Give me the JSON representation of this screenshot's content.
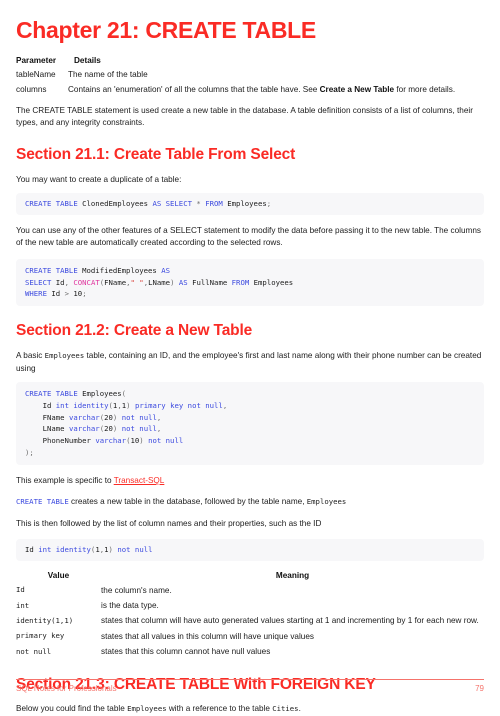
{
  "colors": {
    "heading_red": "#fa2b25",
    "footer_red": "#f5736b",
    "keyword_blue": "#3b49df",
    "function_pink": "#e0359e",
    "string_red": "#d9413a",
    "code_bg": "#f7f7f9",
    "body_text": "#1c1c1c"
  },
  "chapter": {
    "title": "Chapter 21: CREATE TABLE"
  },
  "param_table": {
    "headers": {
      "parameter": "Parameter",
      "details": "Details"
    },
    "rows": [
      {
        "parameter": "tableName",
        "details": "The name of the table"
      },
      {
        "parameter": "columns",
        "details_pre": "Contains an 'enumeration' of all the columns that the table have. See ",
        "details_bold": "Create a New Table",
        "details_post": " for more details."
      }
    ]
  },
  "intro": {
    "paragraph": "The CREATE TABLE statement is used create a new table in the database. A table definition consists of a list of columns, their types, and any integrity constraints."
  },
  "section_1": {
    "title": "Section 21.1: Create Table From Select",
    "para_1": "You may want to create a duplicate of a table:",
    "code_1": "CREATE TABLE ClonedEmployees AS SELECT * FROM Employees;",
    "para_2": "You can use any of the other features of a SELECT statement to modify the data before passing it to the new table. The columns of the new table are automatically created according to the selected rows.",
    "code_2": "CREATE TABLE ModifiedEmployees AS\nSELECT Id, CONCAT(FName,\" \",LName) AS FullName FROM Employees\nWHERE Id > 10;"
  },
  "section_2": {
    "title": "Section 21.2: Create a New Table",
    "para_1_pre": "A basic ",
    "para_1_code": "Employees",
    "para_1_post": " table, containing an ID, and the employee's first and last name along with their phone number can be created using",
    "code_1": "CREATE TABLE Employees(\n    Id int identity(1,1) primary key not null,\n    FName varchar(20) not null,\n    LName varchar(20) not null,\n    PhoneNumber varchar(10) not null\n);",
    "para_2_pre": "This example is specific to ",
    "para_2_link": "Transact-SQL",
    "para_3_code": "CREATE TABLE",
    "para_3_mid": " creates a new table in the database, followed by the table name, ",
    "para_3_code2": "Employees",
    "para_4": "This is then followed by the list of column names and their properties, such as the ID",
    "code_2": "Id int identity(1,1) not null",
    "value_table": {
      "headers": {
        "value": "Value",
        "meaning": "Meaning"
      },
      "rows": [
        {
          "value": "Id",
          "meaning": "the column's name."
        },
        {
          "value": "int",
          "meaning": "is the data type."
        },
        {
          "value": "identity(1,1)",
          "meaning": "states that column will have auto generated values starting at 1 and incrementing by 1 for each new row."
        },
        {
          "value": "primary key",
          "meaning": "states that all values in this column will have unique values"
        },
        {
          "value": "not null",
          "meaning": "states that this column cannot have null values"
        }
      ]
    }
  },
  "section_3": {
    "title": "Section 21.3: CREATE TABLE With FOREIGN KEY",
    "para_1_pre": "Below you could find the table ",
    "para_1_code": "Employees",
    "para_1_mid": " with a reference to the table ",
    "para_1_code2": "Cities",
    "para_1_post": "."
  },
  "footer": {
    "title": "SQL Notes for Professionals",
    "page": "79"
  }
}
